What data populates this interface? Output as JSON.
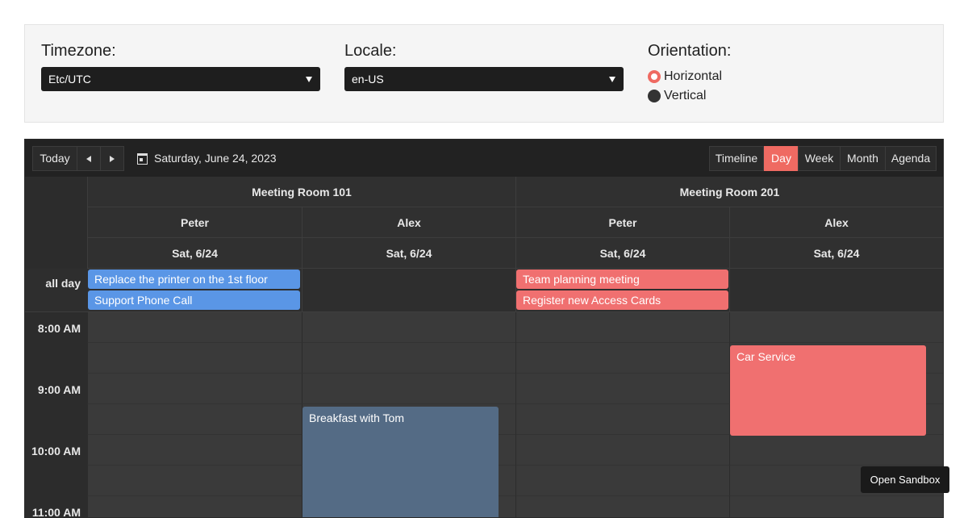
{
  "config": {
    "timezone": {
      "label": "Timezone:",
      "value": "Etc/UTC"
    },
    "locale": {
      "label": "Locale:",
      "value": "en-US"
    },
    "orientation": {
      "label": "Orientation:",
      "options": [
        "Horizontal",
        "Vertical"
      ],
      "selected": "Horizontal"
    }
  },
  "toolbar": {
    "today": "Today",
    "date": "Saturday, June 24, 2023",
    "views": [
      "Timeline",
      "Day",
      "Week",
      "Month",
      "Agenda"
    ],
    "active_view": "Day"
  },
  "resources": [
    {
      "name": "Meeting Room 101",
      "people": [
        "Peter",
        "Alex"
      ]
    },
    {
      "name": "Meeting Room 201",
      "people": [
        "Peter",
        "Alex"
      ]
    }
  ],
  "day_label": "Sat, 6/24",
  "allday_label": "all day",
  "allday_events": [
    {
      "title": "Replace the printer on the 1st floor",
      "color": "#5a96e6"
    },
    {
      "title": "Support Phone Call",
      "color": "#5a96e6"
    },
    {
      "title": "Team planning meeting",
      "color": "#f07070"
    },
    {
      "title": "Register new Access Cards",
      "color": "#f07070"
    }
  ],
  "times": [
    "8:00 AM",
    "9:00 AM",
    "10:00 AM",
    "11:00 AM"
  ],
  "events": [
    {
      "title": "Car Service",
      "color": "#f07070"
    },
    {
      "title": "Breakfast with Tom",
      "color": "#546b85"
    }
  ],
  "sandbox": "Open Sandbox"
}
